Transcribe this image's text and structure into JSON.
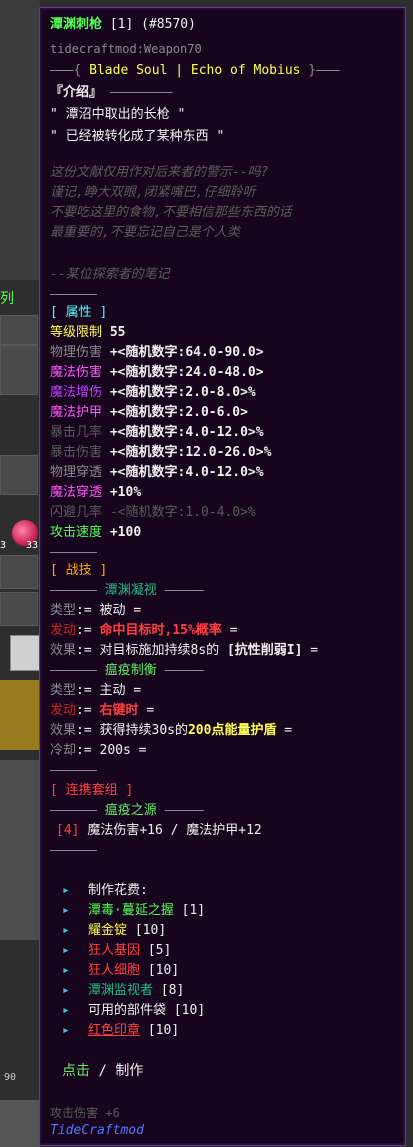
{
  "item": {
    "name": "潭渊刺枪",
    "count": "[1]",
    "id": "(#8570)",
    "registry": "tidecraftmod:Weapon70",
    "series_left": "Blade Soul",
    "series_sep": "|",
    "series_right": "Echo of Mobius",
    "intro_title": "『介绍』",
    "intro_lines": [
      "\" 潭沼中取出的长枪 \"",
      "\" 已经被转化成了某种东西 \""
    ],
    "lore_lines": [
      "这份文献仅用作对后来者的警示--吗?",
      "谨记,睁大双眼,闭紧嘴巴,仔细聆听",
      "不要吃这里的食物,不要相信那些东西的话",
      "最重要的,不要忘记自己是个人类"
    ],
    "lore_sign": "--某位探索者的笔记",
    "attr_title": "[ 属性 ]",
    "attrs": [
      {
        "label": "等级限制",
        "value": "55"
      },
      {
        "label": "物理伤害",
        "value": "+<随机数字:64.0-90.0>"
      },
      {
        "label": "魔法伤害",
        "value": "+<随机数字:24.0-48.0>"
      },
      {
        "label": "魔法增伤",
        "value": "+<随机数字:2.0-8.0>%"
      },
      {
        "label": "魔法护甲",
        "value": "+<随机数字:2.0-6.0>"
      },
      {
        "label": "暴击几率",
        "value": "+<随机数字:4.0-12.0>%"
      },
      {
        "label": "暴击伤害",
        "value": "+<随机数字:12.0-26.0>%"
      },
      {
        "label": "物理穿透",
        "value": "+<随机数字:4.0-12.0>%"
      },
      {
        "label": "魔法穿透",
        "value": "+10%"
      },
      {
        "label": "闪避几率",
        "value": "-<随机数字:1.0-4.0>%"
      },
      {
        "label": "攻击速度",
        "value": "+100"
      }
    ],
    "skill_title": "[ 战技 ]",
    "skill1": {
      "name": "潭渊凝视",
      "type_label": "类型",
      "type_value": "被动",
      "trigger_label": "发动",
      "trigger_value": "命中目标时,15%概率",
      "effect_label": "效果",
      "effect_prefix": "对目标施加持续8s的",
      "effect_value": "[抗性削弱I]"
    },
    "skill2": {
      "name": "瘟疫制衡",
      "type_label": "类型",
      "type_value": "主动",
      "trigger_label": "发动",
      "trigger_value": "右键时",
      "effect_label": "效果",
      "effect_prefix": "获得持续30s的",
      "effect_value": "200点能量护盾",
      "cd_label": "冷却",
      "cd_value": "200s"
    },
    "set_title": "[ 连携套组 ]",
    "set_name": "瘟疫之源",
    "set_count": "[4]",
    "set_bonus": "魔法伤害+16 / 魔法护甲+12",
    "craft_title": "制作花费:",
    "craft_items": [
      {
        "name": "潭毒·蔓延之握",
        "count": "[1]"
      },
      {
        "name": "耀金锭",
        "count": "[10]"
      },
      {
        "name": "狂人基因",
        "count": "[5]"
      },
      {
        "name": "狂人细胞",
        "count": "[10]"
      },
      {
        "name": "潭渊监视者",
        "count": "[8]"
      },
      {
        "name": "可用的部件袋",
        "count": "[10]"
      },
      {
        "name": "红色印章",
        "count": "[10]"
      }
    ],
    "click_label": "点击",
    "slash": "/",
    "make_label": "制作",
    "mod_name": "TideCraftmod",
    "faded_line": "攻击伤害 +6"
  },
  "background": {
    "left_tab_text": "列",
    "stack_num_1": "3",
    "stack_num_2": "33",
    "bar_num": "90"
  }
}
